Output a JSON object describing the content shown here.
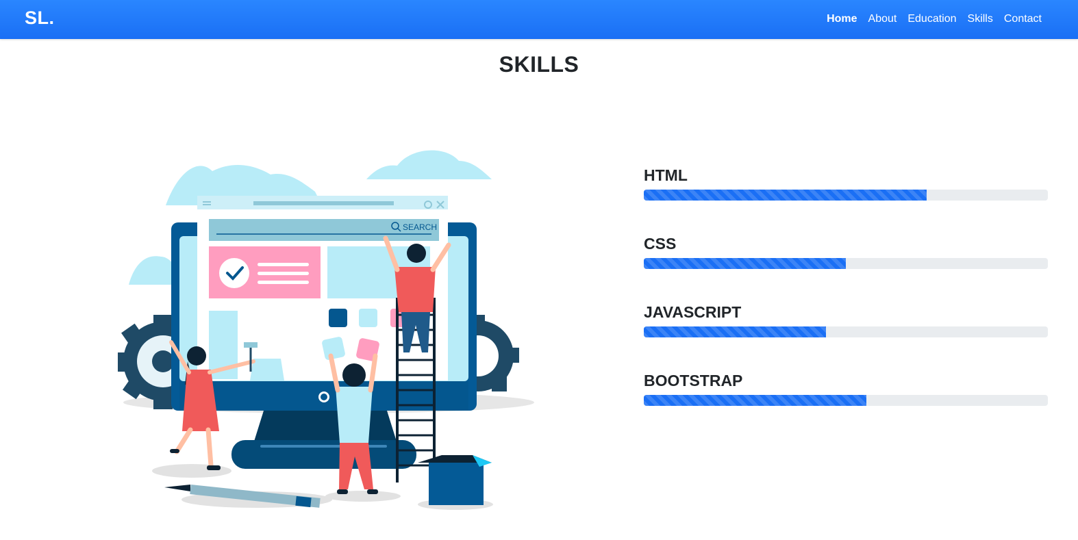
{
  "navbar": {
    "brand": "SL.",
    "links": [
      {
        "label": "Home",
        "active": true
      },
      {
        "label": "About"
      },
      {
        "label": "Education"
      },
      {
        "label": "Skills"
      },
      {
        "label": "Contact"
      }
    ]
  },
  "section": {
    "title": "SKILLS"
  },
  "illustration": {
    "search_text": "SEARCH"
  },
  "skills": [
    {
      "name": "HTML",
      "level": 70
    },
    {
      "name": "CSS",
      "level": 50
    },
    {
      "name": "JAVASCRIPT",
      "level": 45
    },
    {
      "name": "BOOTSTRAP",
      "level": 55
    }
  ],
  "colors": {
    "accent": "#1a6ff5",
    "track": "#e9ecef"
  }
}
